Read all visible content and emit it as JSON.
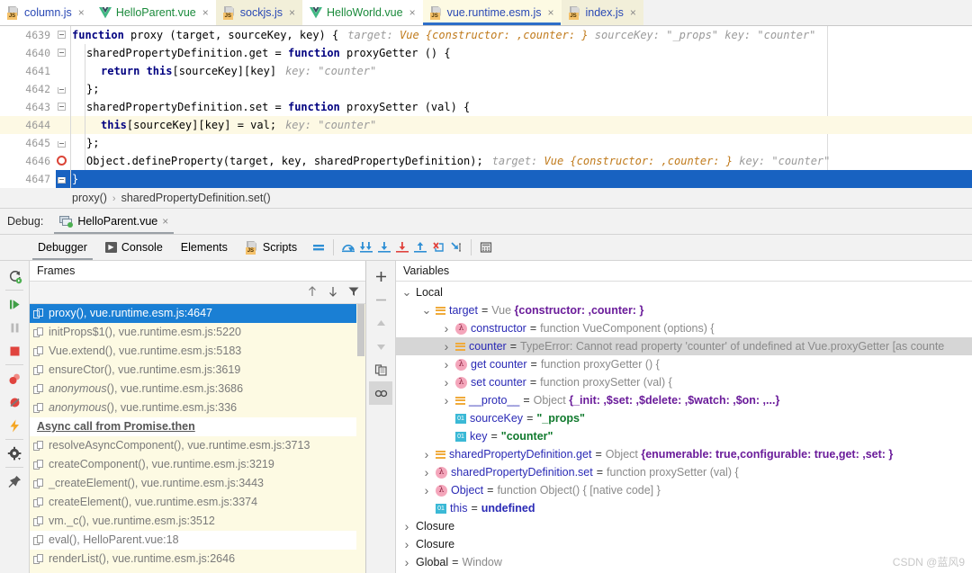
{
  "editor_tabs": [
    {
      "label": "column.js",
      "icon": "js-file-icon",
      "kind": "js",
      "bg": "white",
      "active": false
    },
    {
      "label": "HelloParent.vue",
      "icon": "vue-file-icon",
      "kind": "vue",
      "bg": "white",
      "active": false
    },
    {
      "label": "sockjs.js",
      "icon": "js-file-icon",
      "kind": "js",
      "bg": "cream",
      "active": false
    },
    {
      "label": "HelloWorld.vue",
      "icon": "vue-file-icon",
      "kind": "vue",
      "bg": "white",
      "active": false
    },
    {
      "label": "vue.runtime.esm.js",
      "icon": "js-file-icon",
      "kind": "js",
      "bg": "active",
      "active": true
    },
    {
      "label": "index.js",
      "icon": "js-file-icon",
      "kind": "js",
      "bg": "cream",
      "active": false
    }
  ],
  "code": {
    "lines": [
      {
        "num": "4639",
        "fold": "top",
        "breakpoint": false,
        "highlight": "none",
        "indent": 0,
        "tokens": [
          {
            "t": "function ",
            "c": "kw"
          },
          {
            "t": "proxy (target, sourceKey, key) {",
            "c": "plain"
          }
        ],
        "hint": "target: Vue {constructor: ,counter: }   sourceKey: \"_props\"   key: \"counter\""
      },
      {
        "num": "4640",
        "fold": "top",
        "breakpoint": false,
        "highlight": "none",
        "indent": 1,
        "tokens": [
          {
            "t": "sharedPropertyDefinition.get = ",
            "c": "plain"
          },
          {
            "t": "function ",
            "c": "kw"
          },
          {
            "t": "proxyGetter () {",
            "c": "plain"
          }
        ],
        "hint": ""
      },
      {
        "num": "4641",
        "fold": "none",
        "breakpoint": false,
        "highlight": "none",
        "indent": 2,
        "tokens": [
          {
            "t": "return ",
            "c": "kw"
          },
          {
            "t": "this",
            "c": "kw"
          },
          {
            "t": "[sourceKey][key]",
            "c": "plain"
          }
        ],
        "hint": "key: \"counter\""
      },
      {
        "num": "4642",
        "fold": "bottom",
        "breakpoint": false,
        "highlight": "none",
        "indent": 1,
        "tokens": [
          {
            "t": "};",
            "c": "plain"
          }
        ],
        "hint": ""
      },
      {
        "num": "4643",
        "fold": "top",
        "breakpoint": false,
        "highlight": "none",
        "indent": 1,
        "tokens": [
          {
            "t": "sharedPropertyDefinition.set = ",
            "c": "plain"
          },
          {
            "t": "function ",
            "c": "kw"
          },
          {
            "t": "proxySetter (val) {",
            "c": "plain"
          }
        ],
        "hint": ""
      },
      {
        "num": "4644",
        "fold": "none",
        "breakpoint": false,
        "highlight": "current",
        "indent": 2,
        "tokens": [
          {
            "t": "this",
            "c": "kw"
          },
          {
            "t": "[sourceKey][key] = val;",
            "c": "plain"
          }
        ],
        "hint": "key: \"counter\""
      },
      {
        "num": "4645",
        "fold": "bottom",
        "breakpoint": false,
        "highlight": "none",
        "indent": 1,
        "tokens": [
          {
            "t": "};",
            "c": "plain"
          }
        ],
        "hint": ""
      },
      {
        "num": "4646",
        "fold": "none",
        "breakpoint": true,
        "highlight": "none",
        "indent": 1,
        "tokens": [
          {
            "t": "Object.defineProperty(target, key, sharedPropertyDefinition);",
            "c": "plain"
          }
        ],
        "hint": "target: Vue {constructor: ,counter: }   key: \"counter\""
      },
      {
        "num": "4647",
        "fold": "bottom",
        "breakpoint": false,
        "highlight": "selected",
        "indent": 0,
        "tokens": [
          {
            "t": "}",
            "c": "plain"
          }
        ],
        "hint": ""
      }
    ]
  },
  "breadcrumb": {
    "items": [
      "proxy()",
      "sharedPropertyDefinition.set()"
    ],
    "separator": "›"
  },
  "debug": {
    "label": "Debug:",
    "session_tab": "HelloParent.vue",
    "close": "×"
  },
  "debug_toolbar": {
    "tabs": [
      {
        "label": "Debugger",
        "icon": null,
        "active": true
      },
      {
        "label": "Console",
        "icon": "console-icon",
        "active": false
      },
      {
        "label": "Elements",
        "icon": null,
        "active": false
      },
      {
        "label": "Scripts",
        "icon": "js-file-icon",
        "active": false
      }
    ],
    "actions": [
      "mute-breakpoints-icon",
      "step-over-icon",
      "force-step-over-icon",
      "step-into-icon",
      "force-step-into-icon",
      "step-out-icon",
      "run-to-cursor-icon",
      "drop-frame-icon",
      "evaluate-expression-icon"
    ]
  },
  "left_rail": {
    "buttons": [
      "rerun-icon",
      "resume-program-icon",
      "pause-program-icon",
      "stop-icon",
      "view-breakpoints-icon",
      "mute-breakpoints-icon",
      "lightning-icon",
      "settings-icon",
      "pin-tab-icon"
    ]
  },
  "frames": {
    "title": "Frames",
    "toolbar": [
      "up-arrow-icon",
      "down-arrow-icon",
      "filter-icon"
    ],
    "items": [
      {
        "label": "proxy(), vue.runtime.esm.js:4647",
        "selected": true,
        "italic": false,
        "type": "frame",
        "bg": "selected"
      },
      {
        "label": "initProps$1(), vue.runtime.esm.js:5220",
        "selected": false,
        "italic": false,
        "type": "frame",
        "bg": "cream"
      },
      {
        "label": "Vue.extend(), vue.runtime.esm.js:5183",
        "selected": false,
        "italic": false,
        "type": "frame",
        "bg": "cream"
      },
      {
        "label": "ensureCtor(), vue.runtime.esm.js:3619",
        "selected": false,
        "italic": false,
        "type": "frame",
        "bg": "cream"
      },
      {
        "label": "anonymous(), vue.runtime.esm.js:3686",
        "selected": false,
        "italic": true,
        "type": "frame",
        "bg": "cream"
      },
      {
        "label": "anonymous(), vue.runtime.esm.js:336",
        "selected": false,
        "italic": true,
        "type": "frame",
        "bg": "cream"
      },
      {
        "label": "Async call from Promise.then",
        "selected": false,
        "italic": false,
        "type": "async",
        "bg": "white"
      },
      {
        "label": "resolveAsyncComponent(), vue.runtime.esm.js:3713",
        "selected": false,
        "italic": false,
        "type": "frame",
        "bg": "cream"
      },
      {
        "label": "createComponent(), vue.runtime.esm.js:3219",
        "selected": false,
        "italic": false,
        "type": "frame",
        "bg": "cream"
      },
      {
        "label": "_createElement(), vue.runtime.esm.js:3443",
        "selected": false,
        "italic": false,
        "type": "frame",
        "bg": "cream"
      },
      {
        "label": "createElement(), vue.runtime.esm.js:3374",
        "selected": false,
        "italic": false,
        "type": "frame",
        "bg": "cream"
      },
      {
        "label": "vm._c(), vue.runtime.esm.js:3512",
        "selected": false,
        "italic": false,
        "type": "frame",
        "bg": "cream"
      },
      {
        "label": "eval(), HelloParent.vue:18",
        "selected": false,
        "italic": false,
        "type": "frame",
        "bg": "white"
      },
      {
        "label": "renderList(), vue.runtime.esm.js:2646",
        "selected": false,
        "italic": false,
        "type": "frame",
        "bg": "cream"
      }
    ]
  },
  "variables": {
    "title": "Variables",
    "toolbar": [
      "add-watch-icon",
      "remove-watch-icon",
      "up-arrow-icon",
      "down-arrow-icon",
      "copy-value-icon",
      "inspect-icon"
    ],
    "rows": [
      {
        "indent": 0,
        "twisty": "open",
        "icon": "none",
        "name": "Local",
        "name_style": "plain",
        "eq": "",
        "value": "",
        "selected": false
      },
      {
        "indent": 1,
        "twisty": "open",
        "icon": "object-icon",
        "name": "target",
        "name_style": "var",
        "eq": "=",
        "value": "Vue {constructor: ,counter: }",
        "value_style": "type-bold",
        "selected": false
      },
      {
        "indent": 2,
        "twisty": "closed",
        "icon": "function-icon",
        "name": "constructor",
        "name_style": "var",
        "eq": "=",
        "value": "function VueComponent (options) {",
        "value_style": "type",
        "selected": false
      },
      {
        "indent": 2,
        "twisty": "closed",
        "icon": "object-icon",
        "name": "counter",
        "name_style": "var",
        "eq": "=",
        "value": "TypeError: Cannot read property 'counter' of undefined     at Vue.proxyGetter [as counte",
        "value_style": "err",
        "selected": true
      },
      {
        "indent": 2,
        "twisty": "closed",
        "icon": "function-icon",
        "name": "get counter",
        "name_style": "var",
        "eq": "=",
        "value": "function proxyGetter () {",
        "value_style": "type",
        "selected": false
      },
      {
        "indent": 2,
        "twisty": "closed",
        "icon": "function-icon",
        "name": "set counter",
        "name_style": "var",
        "eq": "=",
        "value": "function proxySetter (val) {",
        "value_style": "type",
        "selected": false
      },
      {
        "indent": 2,
        "twisty": "closed",
        "icon": "object-icon",
        "name": "__proto__",
        "name_style": "var",
        "eq": "=",
        "value": "Object {_init: ,$set: ,$delete: ,$watch: ,$on: ,...}",
        "value_style": "type-bold",
        "selected": false
      },
      {
        "indent": 2,
        "twisty": "none",
        "icon": "primitive-icon",
        "name": "sourceKey",
        "name_style": "var",
        "eq": "=",
        "value": "\"_props\"",
        "value_style": "string",
        "selected": false
      },
      {
        "indent": 2,
        "twisty": "none",
        "icon": "primitive-icon",
        "name": "key",
        "name_style": "var",
        "eq": "=",
        "value": "\"counter\"",
        "value_style": "string",
        "selected": false
      },
      {
        "indent": 1,
        "twisty": "closed",
        "icon": "object-icon",
        "name": "sharedPropertyDefinition.get",
        "name_style": "var",
        "eq": "=",
        "value": "Object {enumerable: true,configurable: true,get: ,set: }",
        "value_style": "type-bold",
        "selected": false
      },
      {
        "indent": 1,
        "twisty": "closed",
        "icon": "function-icon",
        "name": "sharedPropertyDefinition.set",
        "name_style": "var",
        "eq": "=",
        "value": "function proxySetter (val) {",
        "value_style": "type",
        "selected": false
      },
      {
        "indent": 1,
        "twisty": "closed",
        "icon": "function-icon",
        "name": "Object",
        "name_style": "var",
        "eq": "=",
        "value": "function Object() { [native code] }",
        "value_style": "type",
        "selected": false
      },
      {
        "indent": 1,
        "twisty": "none",
        "icon": "primitive-icon",
        "name": "this",
        "name_style": "var",
        "eq": "=",
        "value": "undefined",
        "value_style": "undefined",
        "selected": false
      },
      {
        "indent": 0,
        "twisty": "closed",
        "icon": "none",
        "name": "Closure",
        "name_style": "plain",
        "eq": "",
        "value": "",
        "selected": false
      },
      {
        "indent": 0,
        "twisty": "closed",
        "icon": "none",
        "name": "Closure",
        "name_style": "plain",
        "eq": "",
        "value": "",
        "selected": false
      },
      {
        "indent": 0,
        "twisty": "closed",
        "icon": "none",
        "name": "Global",
        "name_style": "plain",
        "eq": "=",
        "value": "Window",
        "value_style": "type",
        "selected": false
      }
    ]
  },
  "watermark": "CSDN @蓝风9",
  "colors": {
    "accent_blue": "#1862c1",
    "selection_blue": "#1a7fd4",
    "cream": "#fdfae3",
    "current_line": "#fdf9e4",
    "string_green": "#117a2e",
    "keyword_navy": "#000080"
  }
}
